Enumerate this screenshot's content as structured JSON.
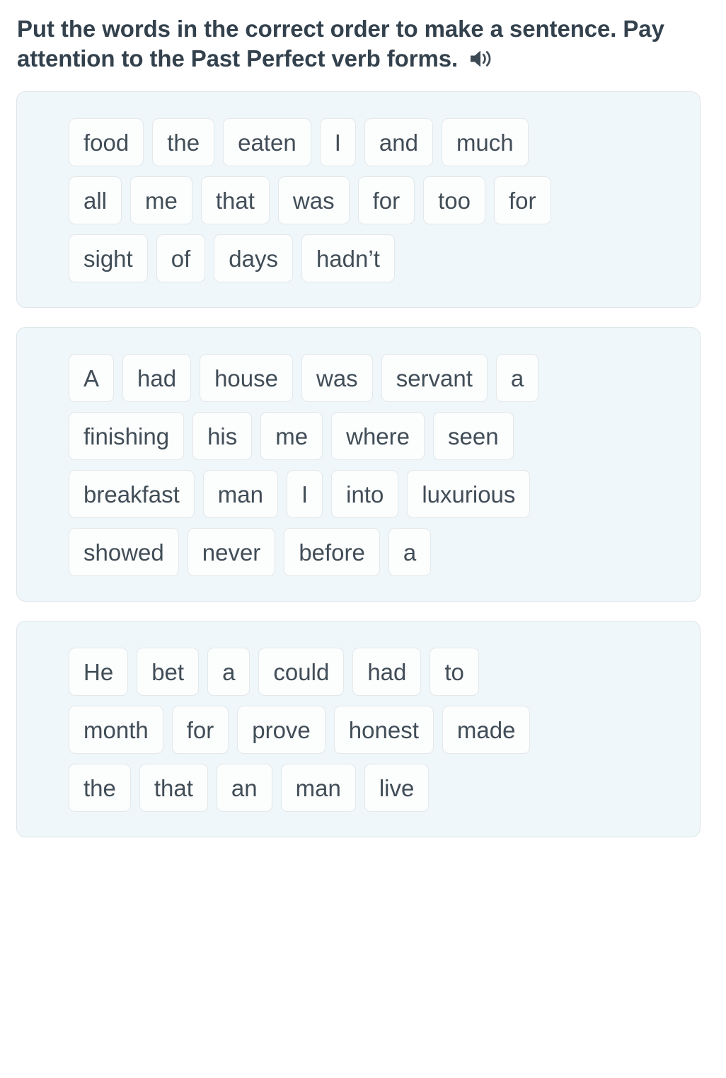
{
  "prompt": {
    "text": "Put the words in the correct order to make a sentence. Pay attention to the Past Perfect verb forms.",
    "audio_icon": "speaker-icon"
  },
  "exercises": [
    {
      "id": "exercise-1",
      "rows": [
        [
          "food",
          "the",
          "eaten",
          "I",
          "and",
          "much"
        ],
        [
          "all",
          "me",
          "that",
          "was",
          "for",
          "too",
          "for"
        ],
        [
          "sight",
          "of",
          "days",
          "hadn’t"
        ]
      ]
    },
    {
      "id": "exercise-2",
      "rows": [
        [
          "A",
          "had",
          "house",
          "was",
          "servant",
          "a"
        ],
        [
          "finishing",
          "his",
          "me",
          "where",
          "seen"
        ],
        [
          "breakfast",
          "man",
          "I",
          "into",
          "luxurious"
        ],
        [
          "showed",
          "never",
          "before",
          "a"
        ]
      ]
    },
    {
      "id": "exercise-3",
      "rows": [
        [
          "He",
          "bet",
          "a",
          "could",
          "had",
          "to"
        ],
        [
          "month",
          "for",
          "prove",
          "honest",
          "made"
        ],
        [
          "the",
          "that",
          "an",
          "man",
          "live"
        ]
      ]
    }
  ],
  "colors": {
    "card_background": "#eff7fa",
    "card_border": "#dfe5e8",
    "chip_background": "#fcfdfd",
    "chip_border": "#e3e8ea",
    "chip_text": "#414d57",
    "prompt_text": "#33414d",
    "page_background": "#ffffff"
  }
}
